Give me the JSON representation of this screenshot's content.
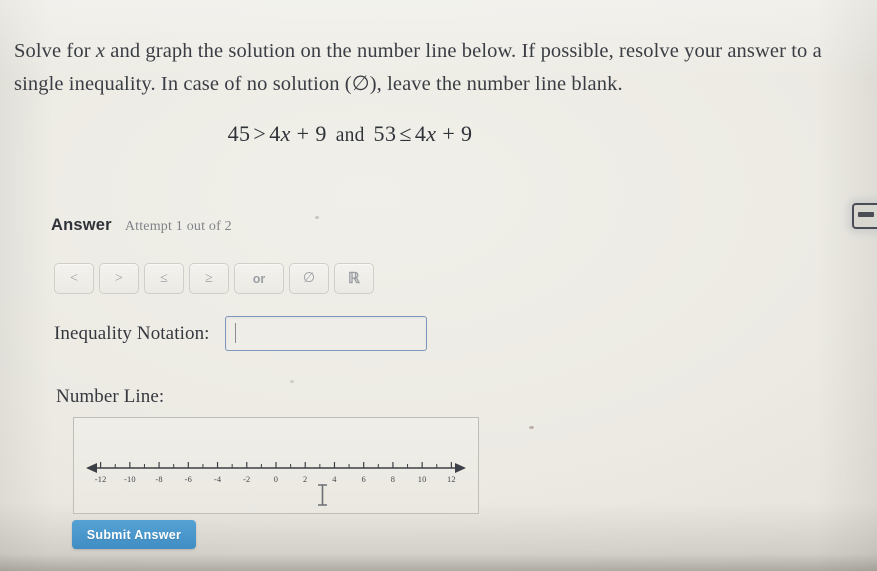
{
  "prompt": {
    "line1_a": "Solve for ",
    "line1_var": "x",
    "line1_b": " and graph the solution on the number line below. If possible, resolve your answer to a single inequality. In case of no solution (∅), leave the number line blank."
  },
  "equation": {
    "left_num": "45",
    "left_op": ">",
    "left_coef": "4",
    "left_var": "x",
    "left_plus": "+ 9",
    "conjunction": "and",
    "right_num": "53",
    "right_op": "≤",
    "right_coef": "4",
    "right_var": "x",
    "right_plus": "+ 9"
  },
  "answer": {
    "title": "Answer",
    "attempt": "Attempt 1 out of 2"
  },
  "keypad": {
    "keys": [
      {
        "label": "<",
        "name": "less-than"
      },
      {
        "label": ">",
        "name": "greater-than"
      },
      {
        "label": "≤",
        "name": "less-than-or-equal"
      },
      {
        "label": "≥",
        "name": "greater-than-or-equal"
      },
      {
        "label": "or",
        "name": "or"
      },
      {
        "label": "∅",
        "name": "empty-set"
      },
      {
        "label": "ℝ",
        "name": "real-numbers"
      }
    ]
  },
  "inequality_notation": {
    "label": "Inequality Notation:",
    "value": "",
    "placeholder": ""
  },
  "number_line": {
    "label": "Number Line:",
    "min": -13,
    "max": 13,
    "labeled_ticks": [
      -12,
      -10,
      -8,
      -6,
      -4,
      -2,
      0,
      2,
      4,
      6,
      8,
      10,
      12
    ],
    "tick_labels": [
      "-12",
      "-10",
      "-8",
      "-6",
      "-4",
      "-2",
      "0",
      "2",
      "4",
      "6",
      "8",
      "10",
      "12"
    ],
    "minor_ticks": [
      -11,
      -9,
      -7,
      -5,
      -3,
      -1,
      1,
      3,
      5,
      7,
      9,
      11
    ],
    "left_arrow": true,
    "right_arrow": true,
    "plotted_points": [],
    "shaded_intervals": []
  },
  "submit": {
    "label": "Submit Answer"
  },
  "colors": {
    "page_bg": "#e9e8e1",
    "text": "#34373d",
    "muted_text": "#7f8389",
    "input_border": "#7d97bd",
    "submit_bg": "#3f8dc4",
    "axis": "#3c3f46"
  }
}
